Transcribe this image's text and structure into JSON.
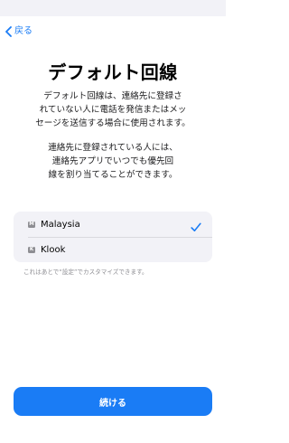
{
  "nav": {
    "back_label": "戻る"
  },
  "title": "デフォルト回線",
  "description": {
    "paragraph1_line1": "デフォルト回線は、連絡先に登録さ",
    "paragraph1_line2": "れていない人に電話を発信またはメッ",
    "paragraph1_line3": "セージを送信する場合に使用されます。",
    "paragraph2_line1": "連絡先に登録されている人には、",
    "paragraph2_line2": "連絡先アプリでいつでも優先回",
    "paragraph2_line3": "線を割り当てることができます。"
  },
  "lines": [
    {
      "badge": "M",
      "label": "Malaysia",
      "selected": true
    },
    {
      "badge": "K",
      "label": "Klook",
      "selected": false
    }
  ],
  "footer_note": "これはあとで“設定”でカスタマイズできます。",
  "continue_label": "続ける",
  "colors": {
    "accent": "#1a7cf5",
    "badge": "#8e8e93",
    "list_background": "#f2f2f7"
  }
}
